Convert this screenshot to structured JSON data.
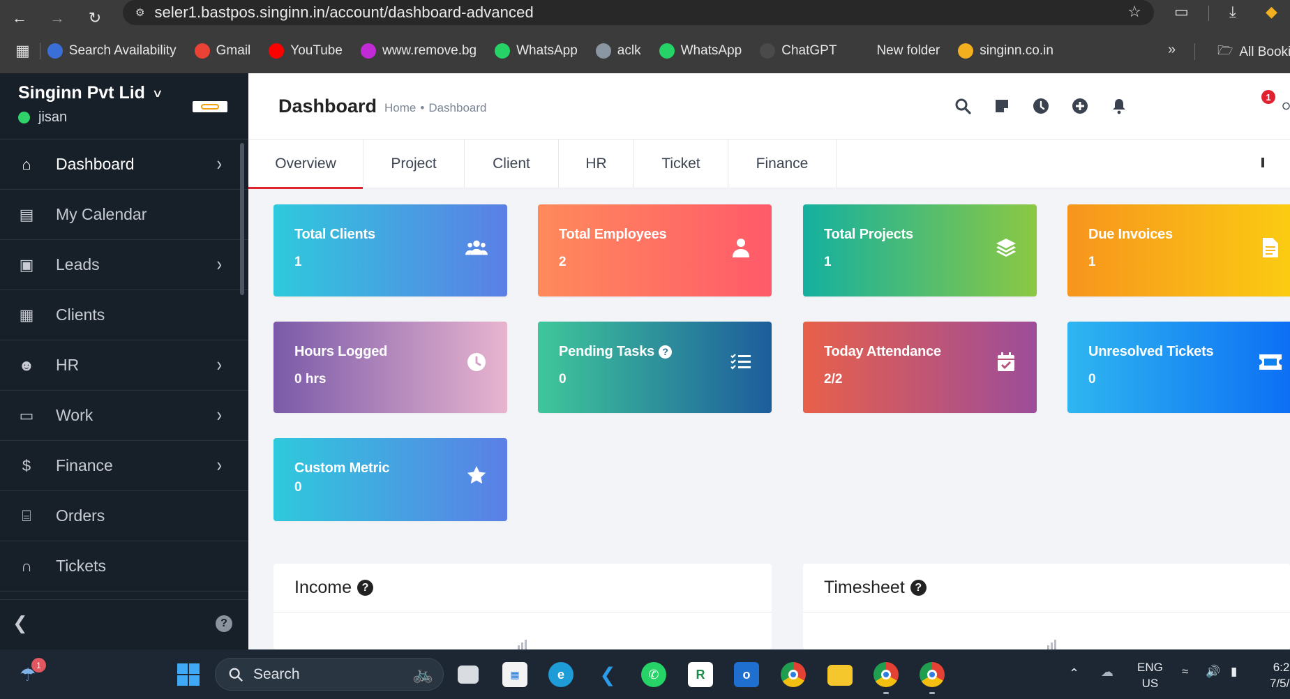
{
  "browser": {
    "url": "seler1.bastpos.singinn.in/account/dashboard-advanced",
    "bookmarks": [
      {
        "label": "Search Availability",
        "icon": "search-availability-icon",
        "color": "#3a6fd8"
      },
      {
        "label": "Gmail",
        "icon": "gmail-icon",
        "color": "#ea4335"
      },
      {
        "label": "YouTube",
        "icon": "youtube-icon",
        "color": "#ff0000"
      },
      {
        "label": "www.remove.bg",
        "icon": "removebg-icon",
        "color": "#c02bd6"
      },
      {
        "label": "WhatsApp",
        "icon": "whatsapp-icon",
        "color": "#25d366"
      },
      {
        "label": "aclk",
        "icon": "globe-icon",
        "color": "#8b96a3"
      },
      {
        "label": "WhatsApp",
        "icon": "whatsapp-icon",
        "color": "#25d366"
      },
      {
        "label": "ChatGPT",
        "icon": "chatgpt-icon",
        "color": "#4a4a4a"
      },
      {
        "label": "New folder",
        "icon": "folder-icon",
        "color": "#3b3b3b"
      },
      {
        "label": "singinn.co.in",
        "icon": "singinn-icon",
        "color": "#f2b01e"
      }
    ],
    "all_bookmarks": "All Booki"
  },
  "sidebar": {
    "company": "Singinn Pvt Lid",
    "user": "jisan",
    "items": [
      {
        "label": "Dashboard",
        "icon": "home-icon",
        "arrow": true,
        "active": true
      },
      {
        "label": "My Calendar",
        "icon": "calendar-icon",
        "arrow": false
      },
      {
        "label": "Leads",
        "icon": "leads-icon",
        "arrow": true
      },
      {
        "label": "Clients",
        "icon": "building-icon",
        "arrow": false
      },
      {
        "label": "HR",
        "icon": "people-icon",
        "arrow": true
      },
      {
        "label": "Work",
        "icon": "briefcase-icon",
        "arrow": true
      },
      {
        "label": "Finance",
        "icon": "dollar-icon",
        "arrow": true
      },
      {
        "label": "Orders",
        "icon": "cart-icon",
        "arrow": false
      },
      {
        "label": "Tickets",
        "icon": "headset-icon",
        "arrow": false
      }
    ],
    "help": "?"
  },
  "header": {
    "title": "Dashboard",
    "breadcrumb_home": "Home",
    "breadcrumb_current": "Dashboard",
    "notification_count": "1"
  },
  "tabs": [
    "Overview",
    "Project",
    "Client",
    "HR",
    "Ticket",
    "Finance"
  ],
  "cards": [
    {
      "label": "Total Clients",
      "value": "1",
      "icon": "users-icon"
    },
    {
      "label": "Total Employees",
      "value": "2",
      "icon": "user-icon"
    },
    {
      "label": "Total Projects",
      "value": "1",
      "icon": "layers-icon"
    },
    {
      "label": "Due Invoices",
      "value": "1",
      "icon": "invoice-icon"
    },
    {
      "label": "Hours Logged",
      "value": "0 hrs",
      "icon": "clock-icon"
    },
    {
      "label": "Pending Tasks",
      "value": "0",
      "icon": "tasks-list-icon",
      "help": true
    },
    {
      "label": "Today Attendance",
      "value": "2/2",
      "icon": "calendar-check-icon"
    },
    {
      "label": "Unresolved Tickets",
      "value": "0",
      "icon": "ticket-icon"
    },
    {
      "label": "Custom Metric",
      "value": "0",
      "icon": "star-icon"
    }
  ],
  "panels": {
    "income_title": "Income",
    "timesheet_title": "Timesheet"
  },
  "taskbar": {
    "search_placeholder": "Search",
    "weather_badge": "1",
    "lang_top": "ENG",
    "lang_bottom": "US",
    "time": "6:2",
    "date": "7/5/"
  }
}
